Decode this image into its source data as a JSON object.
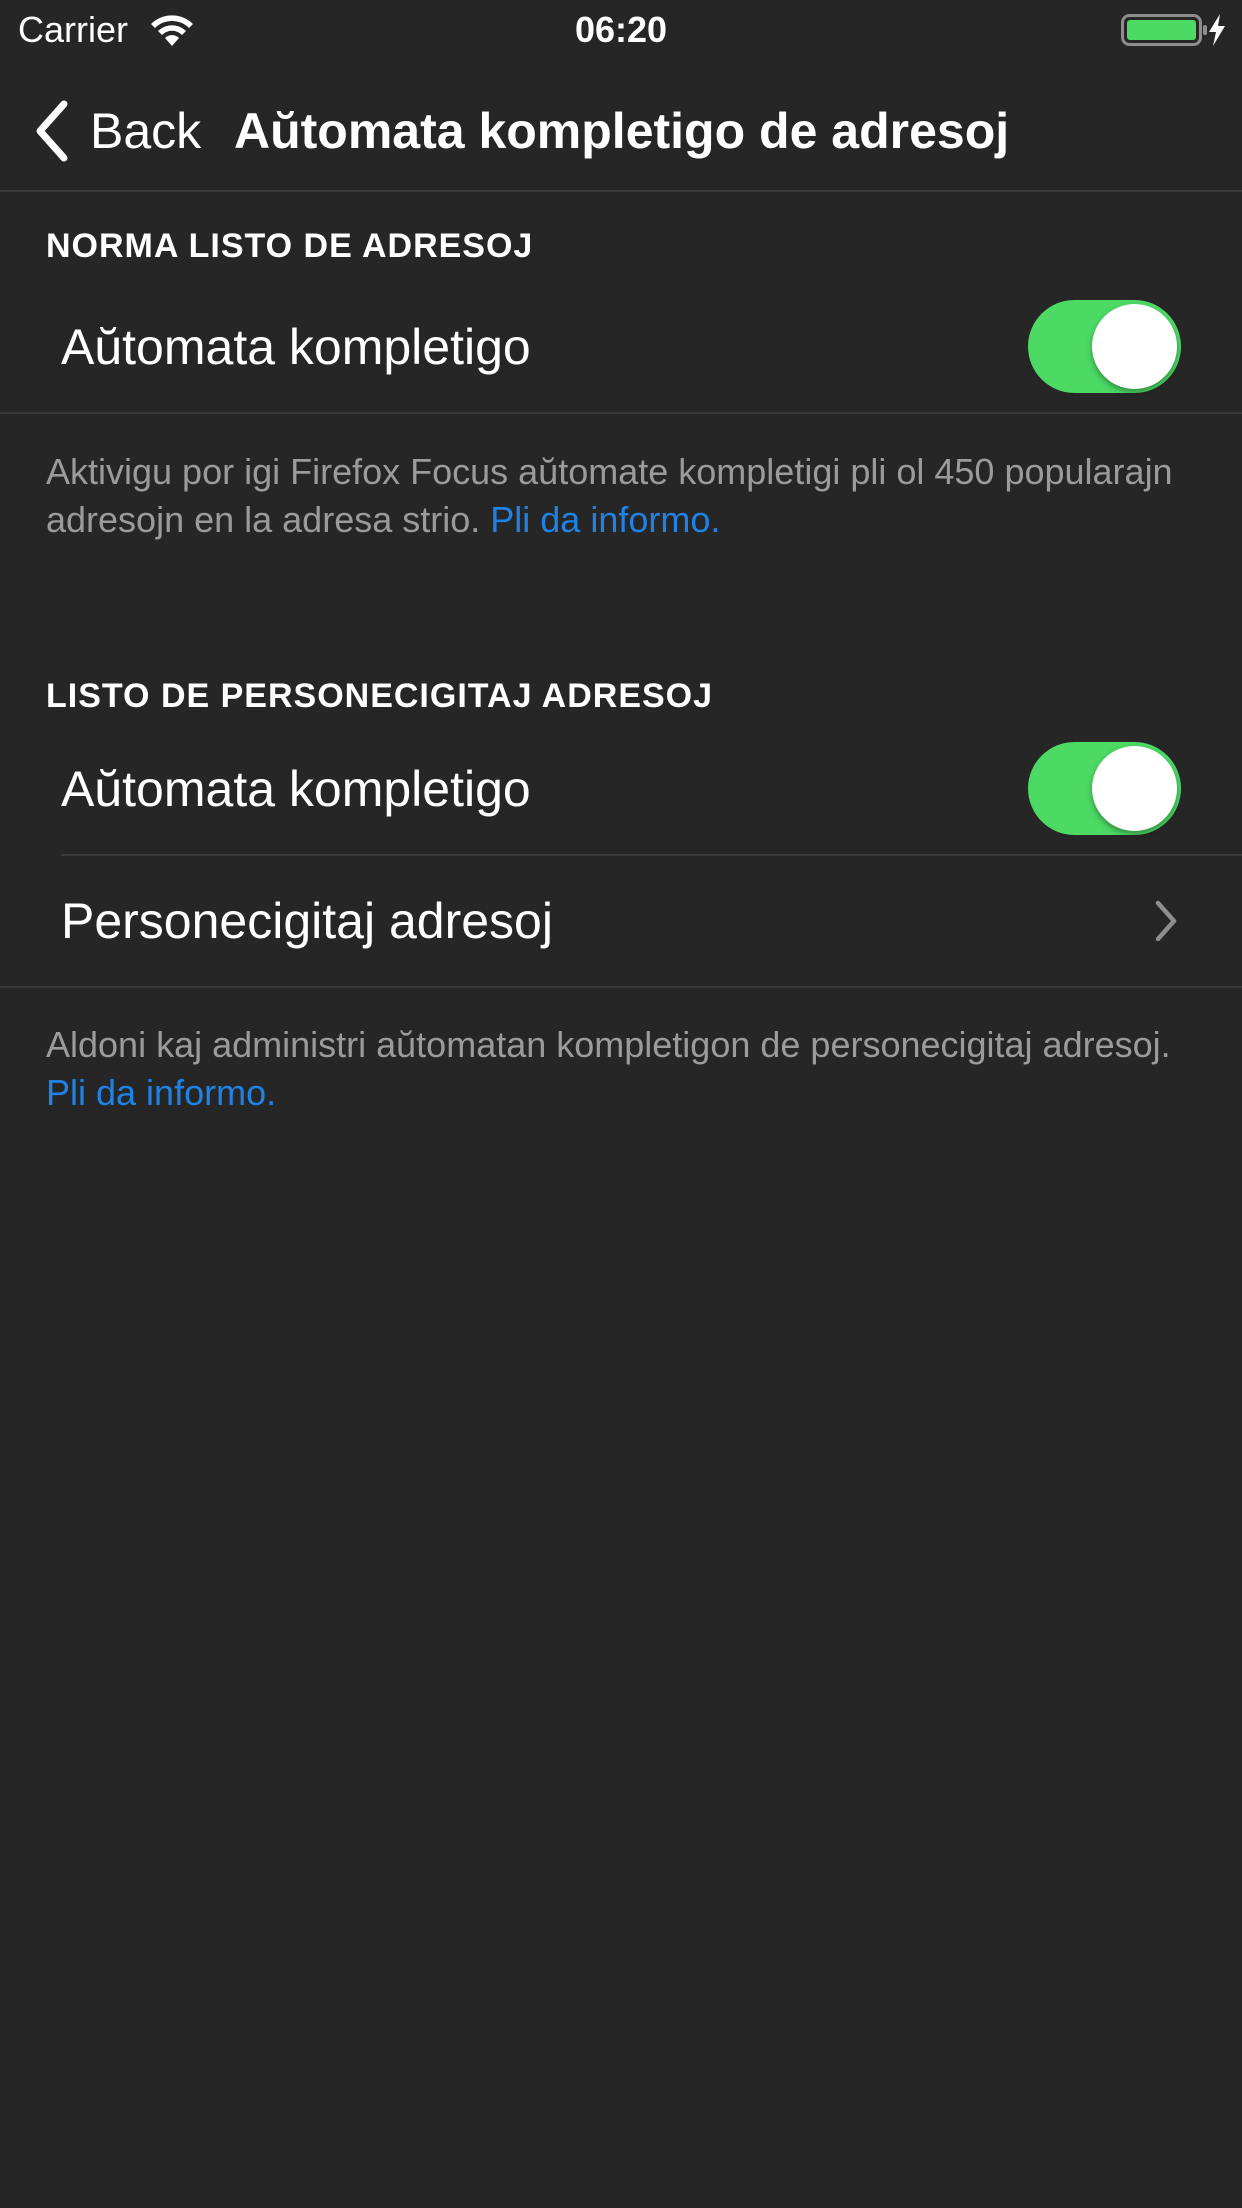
{
  "status_bar": {
    "carrier": "Carrier",
    "time": "06:20",
    "battery_color": "#4cd964"
  },
  "nav": {
    "back_label": "Back",
    "title": "Aŭtomata kompletigo de adresoj"
  },
  "section_default": {
    "header": "NORMA LISTO DE ADRESOJ",
    "toggle_label": "Aŭtomata kompletigo",
    "toggle_on": true,
    "footer_text": "Aktivigu por igi Firefox Focus aŭtomate kompletigi pli ol 450 popularajn adresojn en la adresa strio. ",
    "footer_link": "Pli da informo."
  },
  "section_custom": {
    "header": "LISTO DE PERSONECIGITAJ ADRESOJ",
    "toggle_label": "Aŭtomata kompletigo",
    "toggle_on": true,
    "nav_row_label": "Personecigitaj adresoj",
    "footer_text": "Aldoni kaj administri aŭtomatan kompletigon de personecigitaj adresoj. ",
    "footer_link": "Pli da informo."
  },
  "colors": {
    "background": "#262626",
    "toggle_on": "#4cd964",
    "link": "#1f82e6"
  }
}
